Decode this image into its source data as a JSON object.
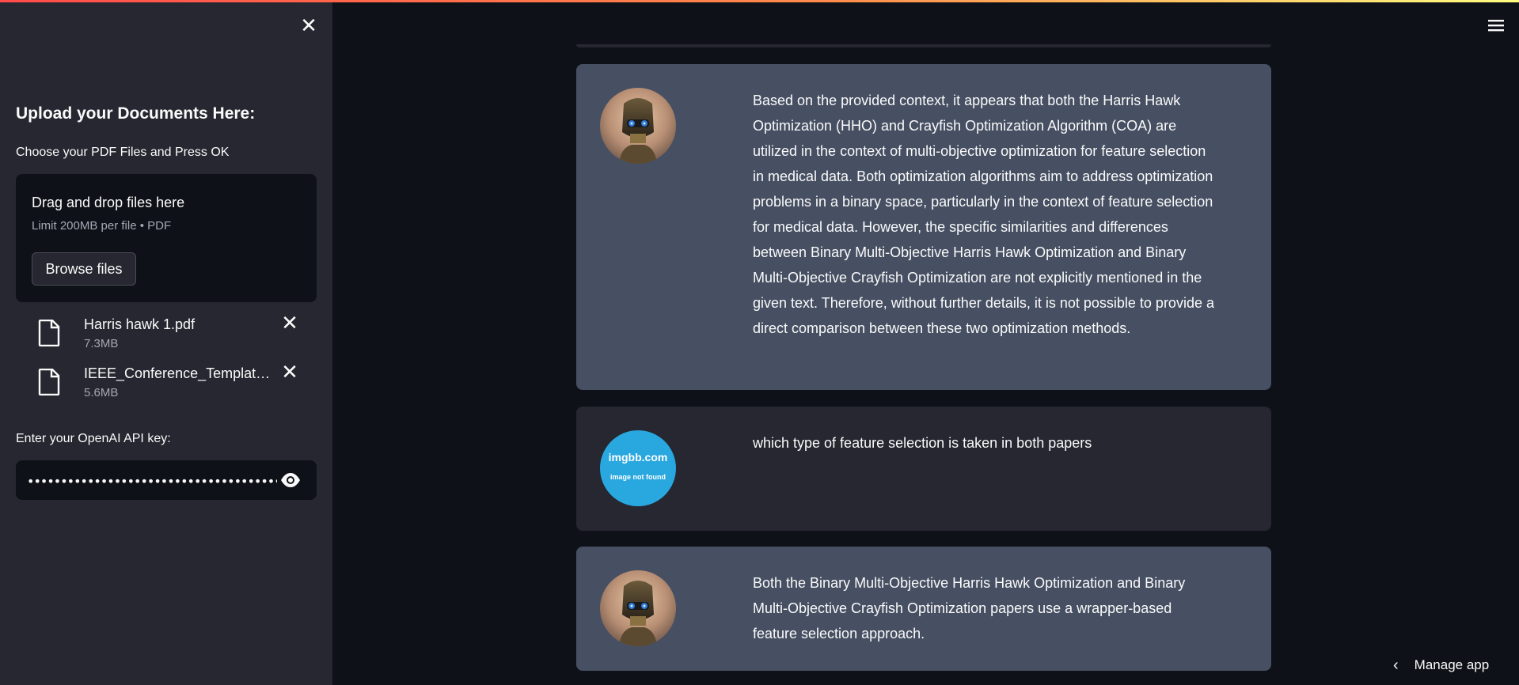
{
  "sidebar": {
    "heading": "Upload your Documents Here:",
    "upload_label": "Choose your PDF Files and Press OK",
    "dropzone": {
      "title": "Drag and drop files here",
      "limit": "Limit 200MB per file • PDF",
      "browse_label": "Browse files"
    },
    "files": [
      {
        "name": "Harris hawk 1.pdf",
        "size": "7.3MB"
      },
      {
        "name": "IEEE_Conference_Template.pdf",
        "size": "5.6MB"
      }
    ],
    "api_key_label": "Enter your OpenAI API key:",
    "api_key_value": "••••••••••••••••••••••••••••••••••••••••••••••••••"
  },
  "chat": {
    "messages": [
      {
        "role": "assistant",
        "text": "Based on the provided context, it appears that both the Harris Hawk Optimization (HHO) and Crayfish Optimization Algorithm (COA) are utilized in the context of multi-objective optimization for feature selection in medical data. Both optimization algorithms aim to address optimization problems in a binary space, particularly in the context of feature selection for medical data. However, the specific similarities and differences between Binary Multi-Objective Harris Hawk Optimization and Binary Multi-Objective Crayfish Optimization are not explicitly mentioned in the given text. Therefore, without further details, it is not possible to provide a direct comparison between these two optimization methods."
      },
      {
        "role": "user",
        "text": "which type of feature selection is taken in both papers",
        "avatar_title": "imgbb.com",
        "avatar_sub": "image not found"
      },
      {
        "role": "assistant",
        "text": "Both the Binary Multi-Objective Harris Hawk Optimization and Binary Multi-Objective Crayfish Optimization papers use a wrapper-based feature selection approach."
      }
    ]
  },
  "footer": {
    "manage_app": "Manage app"
  },
  "colors": {
    "background": "#0e1117",
    "sidebar": "#262730",
    "assistant_bubble": "#475063",
    "user_bubble": "#262730",
    "imgbb_blue": "#29a8e0"
  }
}
